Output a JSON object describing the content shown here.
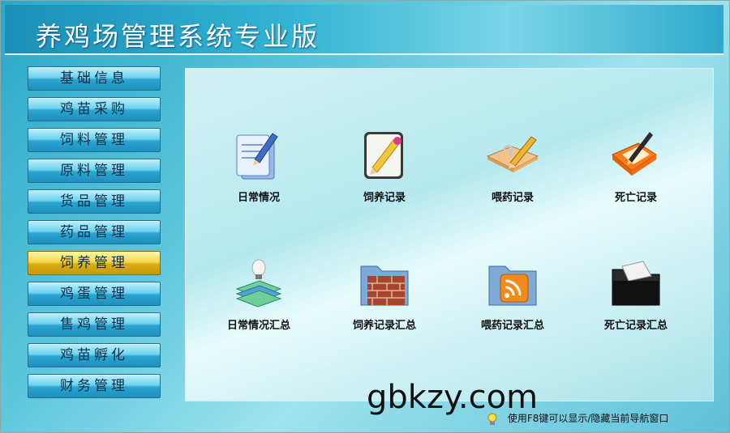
{
  "app": {
    "title": "养鸡场管理系统专业版"
  },
  "sidebar": {
    "items": [
      {
        "label": "基础信息"
      },
      {
        "label": "鸡苗采购"
      },
      {
        "label": "饲料管理"
      },
      {
        "label": "原料管理"
      },
      {
        "label": "货品管理"
      },
      {
        "label": "药品管理"
      },
      {
        "label": "饲养管理",
        "active": true
      },
      {
        "label": "鸡蛋管理"
      },
      {
        "label": "售鸡管理"
      },
      {
        "label": "鸡苗孵化"
      },
      {
        "label": "财务管理"
      }
    ]
  },
  "main": {
    "tiles": [
      {
        "label": "日常情况",
        "icon": "documents-pen-icon"
      },
      {
        "label": "饲养记录",
        "icon": "edit-document-icon"
      },
      {
        "label": "喂药记录",
        "icon": "notebook-pencil-icon"
      },
      {
        "label": "死亡记录",
        "icon": "folder-pen-icon"
      },
      {
        "label": "日常情况汇总",
        "icon": "books-bulb-icon"
      },
      {
        "label": "饲养记录汇总",
        "icon": "brick-folder-icon"
      },
      {
        "label": "喂药记录汇总",
        "icon": "rss-folder-icon"
      },
      {
        "label": "死亡记录汇总",
        "icon": "black-folder-icon"
      }
    ]
  },
  "watermark": "gbkzy.com",
  "status": {
    "hint": "使用F8键可以显示/隐藏当前导航窗口",
    "icon": "lightbulb-icon"
  },
  "colors": {
    "active_nav": "#f5d84a",
    "nav": "#2aa5d0",
    "title_bar": "#1b8fb8"
  }
}
